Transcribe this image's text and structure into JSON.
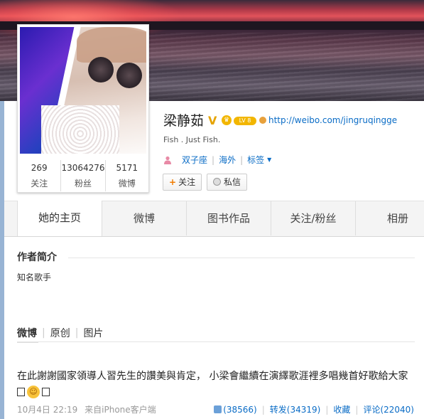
{
  "profile": {
    "name": "梁静茹",
    "verified_mark": "V",
    "level_badge": "LV 8",
    "url": "http://weibo.com/jingruqingge",
    "intro": "Fish . Just Fish.",
    "zodiac": "双子座",
    "location": "海外",
    "tags": "标签",
    "follow_btn": "关注",
    "message_btn": "私信",
    "stats": [
      {
        "num": "269",
        "label": "关注"
      },
      {
        "num": "13064276",
        "label": "粉丝"
      },
      {
        "num": "5171",
        "label": "微博"
      }
    ]
  },
  "tabs": [
    "她的主页",
    "微博",
    "图书作品",
    "关注/粉丝",
    "相册"
  ],
  "author": {
    "section_title": "作者简介",
    "description": "知名歌手"
  },
  "feed_tabs": [
    "微博",
    "原创",
    "图片"
  ],
  "post": {
    "text": "在此謝謝國家領導人習先生的讚美與肯定， 小梁會繼續在演繹歌涯裡多唱幾首好歌給大家",
    "time": "10月4日 22:19",
    "source": "来自iPhone客户端",
    "likes": "(38566)",
    "repost": "转发(34319)",
    "favorite": "收藏",
    "comment": "评论(22040)"
  },
  "colors": {
    "link": "#0a6cc6",
    "badge": "#f2b600"
  }
}
